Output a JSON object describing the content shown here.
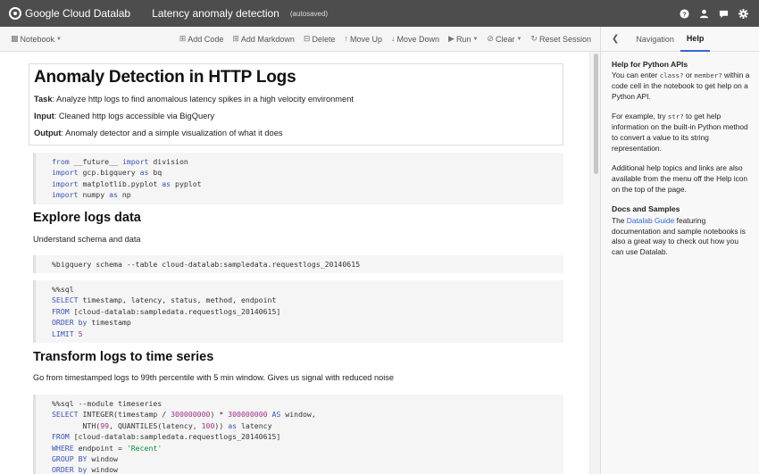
{
  "topbar": {
    "brand": "Google Cloud Datalab",
    "title": "Latency anomaly detection",
    "autosave": "(autosaved)",
    "icons": [
      "help-icon",
      "account-icon",
      "feedback-icon",
      "settings-icon"
    ]
  },
  "toolbar": {
    "notebook": "Notebook",
    "add_code": "Add Code",
    "add_markdown": "Add Markdown",
    "delete": "Delete",
    "move_up": "Move Up",
    "move_down": "Move Down",
    "run": "Run",
    "clear": "Clear",
    "reset_session": "Reset Session"
  },
  "right_panel": {
    "tab_navigation": "Navigation",
    "tab_help": "Help",
    "h1": "Help for Python APIs",
    "p1_a": "You can enter ",
    "p1_code1": "class?",
    "p1_b": " or ",
    "p1_code2": "member?",
    "p1_c": " within a code cell in the notebook to get help on a Python API.",
    "p2_a": "For example, try ",
    "p2_code": "str?",
    "p2_b": " to get help information on the built-in Python method to convert a value to its string representation.",
    "p3": "Additional help topics and links are also available from the menu off the Help icon on the top of the page.",
    "h2": "Docs and Samples",
    "p4_a": "The ",
    "p4_link": "Datalab Guide",
    "p4_b": " featuring documentation and sample notebooks is also a great way to check out how you can use Datalab."
  },
  "notebook": {
    "title": "Anomaly Detection in HTTP Logs",
    "task_label": "Task",
    "task": ": Analyze http logs to find anomalous latency spikes in a high velocity environment",
    "input_label": "Input",
    "input": ": Cleaned http logs accessible via BigQuery",
    "output_label": "Output",
    "output": ": Anomaly detector and a simple visualization of what it does",
    "code1": [
      [
        [
          "kw",
          "from"
        ],
        [
          "t",
          " __future__ "
        ],
        [
          "kw",
          "import"
        ],
        [
          "t",
          " division"
        ]
      ],
      [
        [
          "kw",
          "import"
        ],
        [
          "t",
          " gcp.bigquery "
        ],
        [
          "kw",
          "as"
        ],
        [
          "t",
          " bq"
        ]
      ],
      [
        [
          "kw",
          "import"
        ],
        [
          "t",
          " matplotlib.pyplot "
        ],
        [
          "kw",
          "as"
        ],
        [
          "t",
          " pyplot"
        ]
      ],
      [
        [
          "kw",
          "import"
        ],
        [
          "t",
          " numpy "
        ],
        [
          "kw",
          "as"
        ],
        [
          "t",
          " np"
        ]
      ]
    ],
    "h_explore": "Explore logs data",
    "explore_sub": "Understand schema and data",
    "code2": [
      [
        [
          "t",
          "%bigquery schema --table cloud-datalab:sampledata.requestlogs_20140615"
        ]
      ]
    ],
    "code3": [
      [
        [
          "t",
          "%%sql"
        ]
      ],
      [
        [
          "kw",
          "SELECT"
        ],
        [
          "t",
          " timestamp, latency, status, method, endpoint"
        ]
      ],
      [
        [
          "kw",
          "FROM"
        ],
        [
          "t",
          " [cloud-datalab:sampledata.requestlogs_20140615]"
        ]
      ],
      [
        [
          "kw",
          "ORDER"
        ],
        [
          "t",
          " "
        ],
        [
          "kw",
          "by"
        ],
        [
          "t",
          " timestamp"
        ]
      ],
      [
        [
          "kw",
          "LIMIT"
        ],
        [
          "t",
          " "
        ],
        [
          "num",
          "5"
        ]
      ]
    ],
    "h_transform": "Transform logs to time series",
    "transform_sub": "Go from timestamped logs to 99th percentile with 5 min window. Gives us signal with reduced noise",
    "code4": [
      [
        [
          "t",
          "%%sql --module timeseries"
        ]
      ],
      [
        [
          "kw",
          "SELECT"
        ],
        [
          "t",
          " INTEGER(timestamp / "
        ],
        [
          "num",
          "300000000"
        ],
        [
          "t",
          ") * "
        ],
        [
          "num",
          "300000000"
        ],
        [
          "t",
          " "
        ],
        [
          "kw",
          "AS"
        ],
        [
          "t",
          " window,"
        ]
      ],
      [
        [
          "t",
          "       NTH("
        ],
        [
          "num",
          "99"
        ],
        [
          "t",
          ", QUANTILES(latency, "
        ],
        [
          "num",
          "100"
        ],
        [
          "t",
          ")) "
        ],
        [
          "kw",
          "as"
        ],
        [
          "t",
          " latency"
        ]
      ],
      [
        [
          "kw",
          "FROM"
        ],
        [
          "t",
          " [cloud-datalab:sampledata.requestlogs_20140615]"
        ]
      ],
      [
        [
          "kw",
          "WHERE"
        ],
        [
          "t",
          " endpoint = "
        ],
        [
          "str",
          "'Recent'"
        ]
      ],
      [
        [
          "kw",
          "GROUP"
        ],
        [
          "t",
          " "
        ],
        [
          "kw",
          "BY"
        ],
        [
          "t",
          " window"
        ]
      ],
      [
        [
          "kw",
          "ORDER"
        ],
        [
          "t",
          " "
        ],
        [
          "kw",
          "by"
        ],
        [
          "t",
          " window"
        ]
      ]
    ]
  }
}
